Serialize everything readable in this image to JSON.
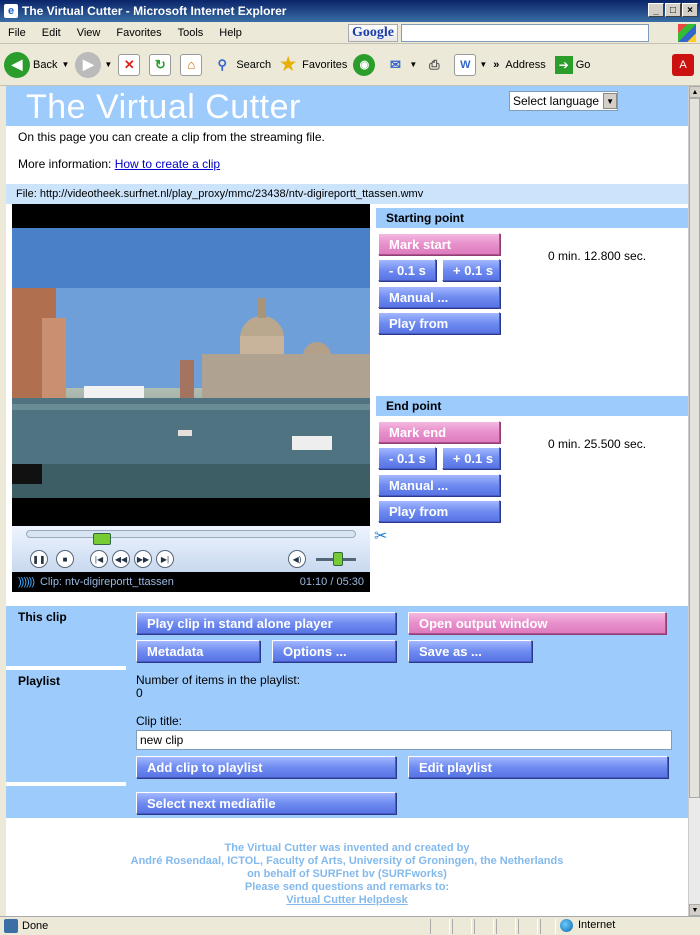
{
  "window": {
    "title": "The Virtual Cutter - Microsoft Internet Explorer",
    "controls": [
      "_",
      "□",
      "×"
    ]
  },
  "menubar": {
    "items": [
      "File",
      "Edit",
      "View",
      "Favorites",
      "Tools",
      "Help"
    ],
    "google_label": "Google",
    "google_query": ""
  },
  "toolbar": {
    "back": "Back",
    "search": "Search",
    "favorites": "Favorites",
    "chevron": "»",
    "address": "Address",
    "go": "Go"
  },
  "page": {
    "title": "The Virtual Cutter",
    "language_select": "Select language",
    "intro": "On this page you can create a clip from the streaming file.",
    "more_info_label": "More information:",
    "more_info_link": "How to create a clip",
    "file": "File: http://videotheek.surfnet.nl/play_proxy/mmc/23438/ntv-digireportt_ttassen.wmv"
  },
  "player": {
    "clip_label": "Clip: ntv-digireportt_ttassen",
    "time": "01:10 / 05:30",
    "progress": 0.21,
    "volume": 0.55
  },
  "starting_point": {
    "heading": "Starting point",
    "mark": "Mark start",
    "minus": "- 0.1 s",
    "plus": "+ 0.1 s",
    "manual": "Manual ...",
    "play_from": "Play from",
    "time": "0 min. 12.800 sec."
  },
  "end_point": {
    "heading": "End point",
    "mark": "Mark end",
    "minus": "- 0.1 s",
    "plus": "+ 0.1 s",
    "manual": "Manual ...",
    "play_from": "Play from",
    "time": "0 min. 25.500 sec."
  },
  "this_clip": {
    "label": "This clip",
    "play_standalone": "Play clip in stand alone player",
    "open_output": "Open output window",
    "metadata": "Metadata",
    "options": "Options ...",
    "save_as": "Save as ..."
  },
  "playlist": {
    "label": "Playlist",
    "count_label": "Number of items in the playlist:",
    "count": "0",
    "clip_title_label": "Clip title:",
    "clip_title_value": "new clip",
    "add": "Add clip to playlist",
    "edit": "Edit playlist",
    "select_next": "Select next mediafile"
  },
  "footer": {
    "line1": "The Virtual Cutter was invented and created by",
    "line2": "André Rosendaal, ICTOL, Faculty of Arts, University of Groningen, the Netherlands",
    "line3": "on behalf of SURFnet bv (SURFworks)",
    "line4": "Please send questions and remarks to:",
    "helpdesk": "Virtual Cutter Helpdesk"
  },
  "statusbar": {
    "status": "Done",
    "zone": "Internet"
  },
  "colors": {
    "band": "#9ccbfc",
    "button_blue": "#6f8cf0",
    "button_pink": "#e890cc",
    "footer_text": "#84b9ec"
  }
}
